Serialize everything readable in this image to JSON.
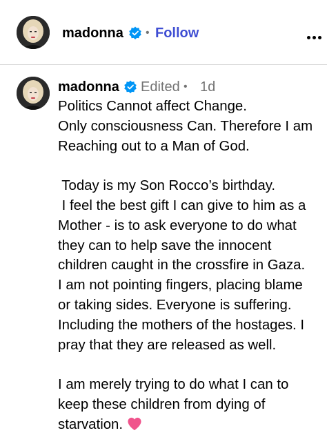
{
  "header": {
    "username": "madonna",
    "verified_icon": "verified-badge-icon",
    "separator": "•",
    "follow_label": "Follow",
    "more_icon": "more-options-icon"
  },
  "post": {
    "username": "madonna",
    "verified_icon": "verified-badge-icon",
    "edited_label": "Edited",
    "separator": "•",
    "timestamp": "1d",
    "caption_lines": [
      "Politics Cannot affect Change.",
      "Only consciousness Can. Therefore I am",
      "Reaching out to a Man of God.",
      "",
      " Today is my Son Rocco’s birthday.",
      " I feel the best gift I can give to him as a",
      "Mother - is to ask everyone to do what",
      "they can to help save the innocent",
      "children caught in the crossfire in Gaza.",
      "I am not pointing fingers, placing blame",
      "or taking sides. Everyone is suffering.",
      "Including the mothers of the hostages. I",
      "pray that they are released as well.",
      "",
      "I am merely trying to do what I can to",
      "keep these children from dying of",
      "starvation."
    ],
    "caption_end_icon": "pink-heart-emoji"
  },
  "colors": {
    "follow_blue": "#3f4ed3",
    "verified_blue": "#0095f6",
    "muted_gray": "#737373",
    "divider": "#dbdbdb",
    "heart_pink": "#f0548c"
  }
}
